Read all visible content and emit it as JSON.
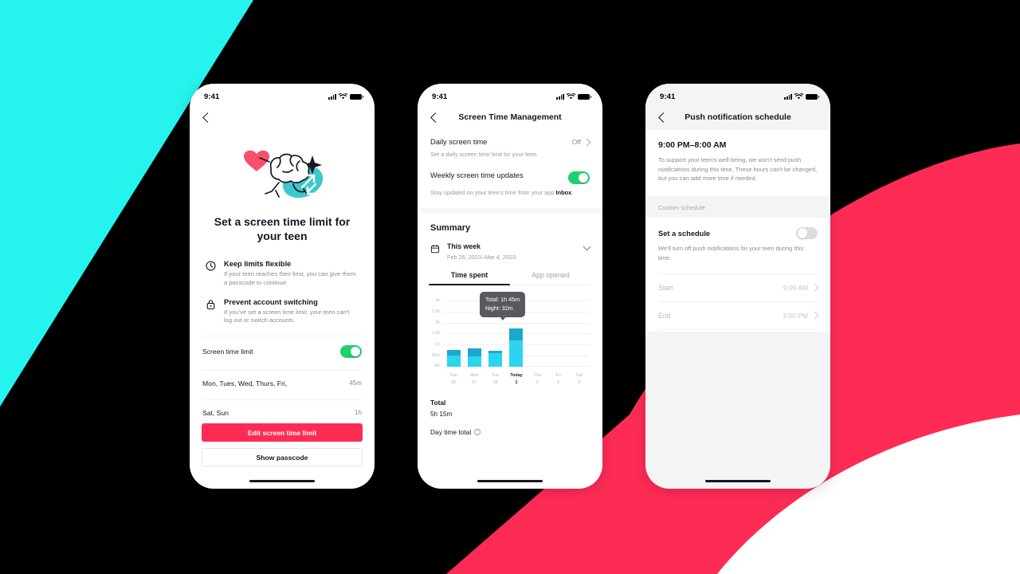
{
  "theme": {
    "brand_red": "#FE2C55",
    "brand_cyan": "#25F4EE",
    "black": "#000000",
    "toggle_green": "#20D06E",
    "chart_day": "#2DD4EE",
    "chart_night": "#1BA8CC"
  },
  "status_bar": {
    "time": "9:41",
    "signal_icon": "cellular-bars-icon",
    "wifi_icon": "wifi-icon",
    "battery_icon": "battery-icon"
  },
  "phone1": {
    "back_icon": "back-chevron-icon",
    "illustration": "running-brain-heart-illustration",
    "title": "Set a screen time limit for your teen",
    "features": [
      {
        "icon": "clock-icon",
        "heading": "Keep limits flexible",
        "text": "If your teen reaches their limit, you can give them a passcode to continue"
      },
      {
        "icon": "lock-icon",
        "heading": "Prevent account switching",
        "text": "If you've set a screen time limit, your teen can't log out or switch accounts"
      }
    ],
    "toggle_row": {
      "label": "Screen time limit",
      "state": "on"
    },
    "schedule_rows": [
      {
        "label": "Mon, Tues, Wed, Thurs, Fri,",
        "value": "45m"
      },
      {
        "label": "Sat, Sun",
        "value": "1h"
      }
    ],
    "primary_button": "Edit screen time limit",
    "secondary_button": "Show passcode"
  },
  "phone2": {
    "back_icon": "back-chevron-icon",
    "title": "Screen Time Management",
    "daily": {
      "label": "Daily screen time",
      "value": "Off",
      "chevron": "chevron-right-icon",
      "sub": "Set a daily screen time limit for your teen."
    },
    "weekly": {
      "label": "Weekly screen time updates",
      "state": "on",
      "sub_prefix": "Stay updated on your teen's time from your app ",
      "sub_bold": "Inbox",
      "sub_suffix": "."
    },
    "summary_title": "Summary",
    "period": {
      "icon": "calendar-icon",
      "label": "This week",
      "range": "Feb 26, 2023–Mar 4, 2023",
      "chevron": "chevron-down-icon"
    },
    "tabs": [
      {
        "label": "Time spent",
        "active": true
      },
      {
        "label": "App opened",
        "active": false
      }
    ],
    "tooltip": {
      "line1": "Total: 1h 45m",
      "line2": "Night: 32m"
    },
    "total_label": "Total",
    "total_value": "5h 15m",
    "daytime_label": "Day time total",
    "daytime_icon": "info-icon"
  },
  "chart_data": {
    "type": "bar",
    "title": "Time spent",
    "xlabel": "",
    "ylabel": "",
    "grid": true,
    "legend_position": "none",
    "ylim": [
      0,
      3
    ],
    "ytick_labels": [
      "3h",
      "2.5h",
      "2h",
      "1.5h",
      "1h",
      "30m",
      "0m"
    ],
    "ytick_values": [
      3,
      2.5,
      2,
      1.5,
      1,
      0.5,
      0
    ],
    "categories": [
      "Sun",
      "Mon",
      "Tue",
      "Today",
      "Thu",
      "Fri",
      "Sat"
    ],
    "category_sublabels": [
      "26",
      "27",
      "28",
      "1",
      "2",
      "3",
      "4"
    ],
    "series": [
      {
        "name": "Day",
        "color": "#2DD4EE",
        "values": [
          0.52,
          0.48,
          0.63,
          1.22
        ]
      },
      {
        "name": "Night",
        "color": "#1BA8CC",
        "values": [
          0.25,
          0.38,
          0.12,
          0.53
        ]
      }
    ],
    "units": "hours",
    "annotation": "Total: 1h 45m / Night: 32m on Today"
  },
  "phone3": {
    "back_icon": "back-chevron-icon",
    "title": "Push notification schedule",
    "time_range": "9:00 PM–8:00 AM",
    "description": "To support your teen's well-being, we won't send push notifications during this time. These hours can't be changed, but you can add more time if needed.",
    "section_label": "Custom schedule",
    "set_schedule": {
      "label": "Set a schedule",
      "state": "off",
      "sub": "We'll turn off push notifications for your teen during this time."
    },
    "items": [
      {
        "label": "Start",
        "value": "9:00 AM",
        "chevron": "chevron-right-icon"
      },
      {
        "label": "End",
        "value": "3:00 PM",
        "chevron": "chevron-right-icon"
      }
    ]
  }
}
